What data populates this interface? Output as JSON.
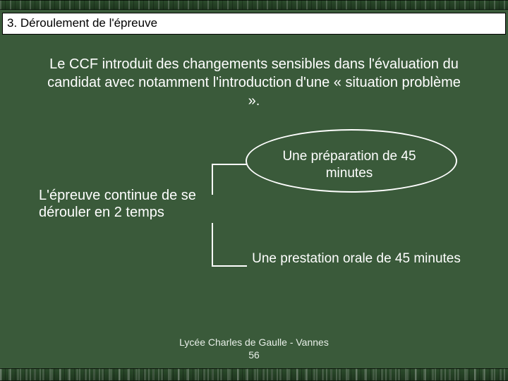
{
  "title": "3. Déroulement de l'épreuve",
  "intro": "Le CCF introduit des changements sensibles dans l'évaluation du candidat avec notamment l'introduction d'une « situation problème ».",
  "left": "L'épreuve continue de se dérouler en 2 temps",
  "right_top": "Une préparation de 45 minutes",
  "right_bottom": "Une prestation orale de 45 minutes",
  "footer_line1": "Lycée Charles de Gaulle - Vannes",
  "footer_line2": "56"
}
